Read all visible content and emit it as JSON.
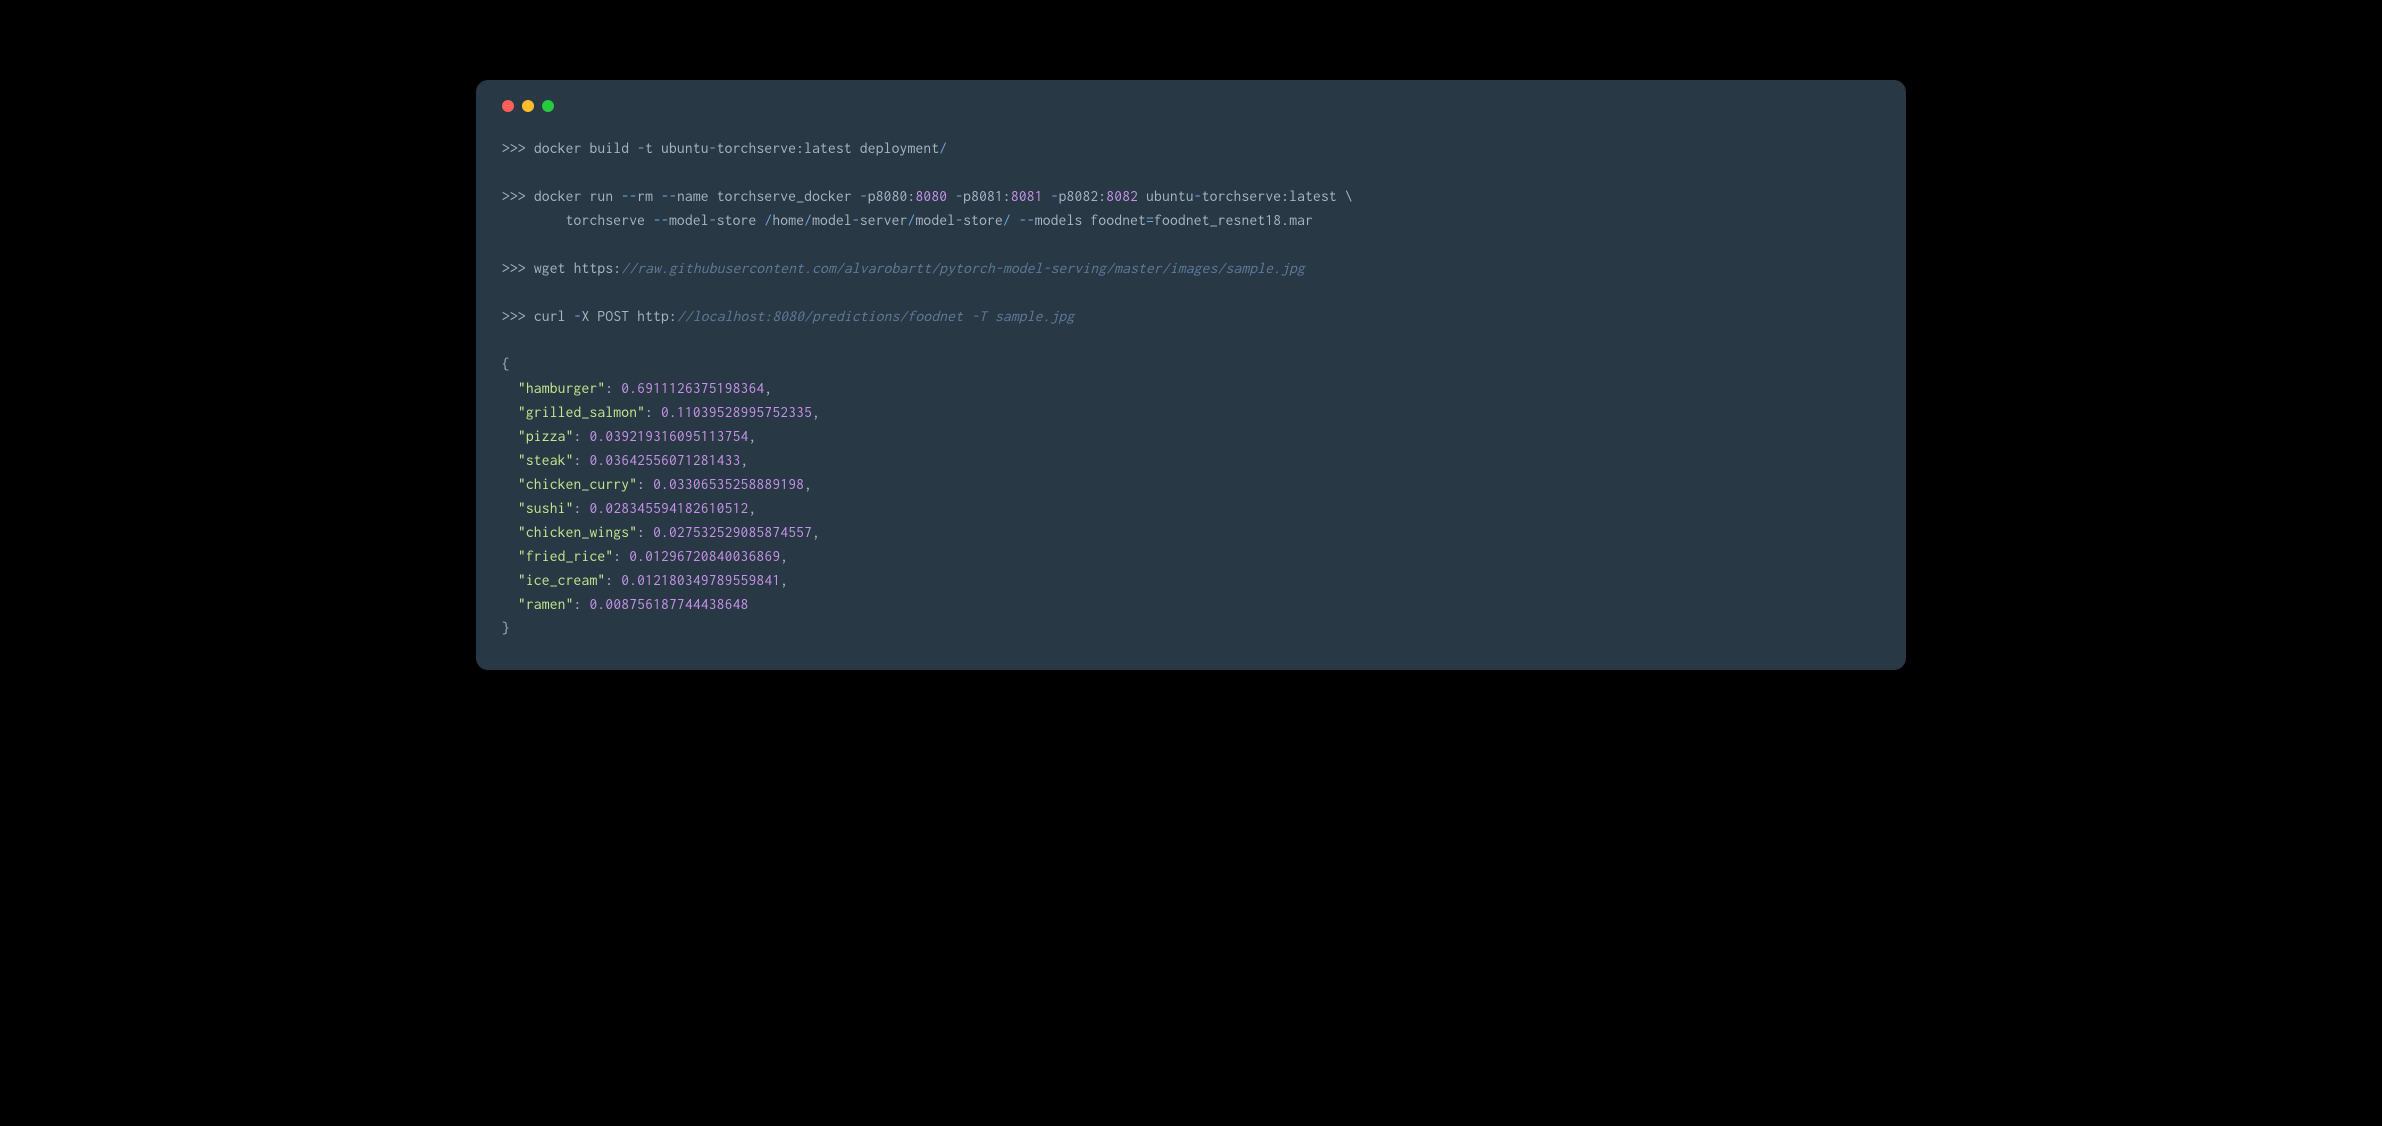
{
  "colors": {
    "bg": "#000000",
    "window_bg": "#293845",
    "text": "#a6b4c4",
    "operator": "#6ea3d6",
    "number": "#c792ea",
    "string": "#c3e88d",
    "comment": "#5f7a99",
    "tl_red": "#ff5f56",
    "tl_yellow": "#ffbd2e",
    "tl_green": "#27c93f"
  },
  "lines": [
    {
      "type": "cmd",
      "tokens": [
        {
          "cls": "prompt",
          "text": ">>> "
        },
        {
          "cls": "text",
          "text": "docker build "
        },
        {
          "cls": "op",
          "text": "-"
        },
        {
          "cls": "text",
          "text": "t ubuntu"
        },
        {
          "cls": "op",
          "text": "-"
        },
        {
          "cls": "text",
          "text": "torchserve:latest deployment"
        },
        {
          "cls": "op",
          "text": "/"
        }
      ]
    },
    {
      "type": "blank"
    },
    {
      "type": "cmd",
      "tokens": [
        {
          "cls": "prompt",
          "text": ">>> "
        },
        {
          "cls": "text",
          "text": "docker run "
        },
        {
          "cls": "op",
          "text": "--"
        },
        {
          "cls": "text",
          "text": "rm "
        },
        {
          "cls": "op",
          "text": "--"
        },
        {
          "cls": "text",
          "text": "name torchserve_docker "
        },
        {
          "cls": "op",
          "text": "-"
        },
        {
          "cls": "text",
          "text": "p8080:"
        },
        {
          "cls": "num",
          "text": "8080"
        },
        {
          "cls": "text",
          "text": " "
        },
        {
          "cls": "op",
          "text": "-"
        },
        {
          "cls": "text",
          "text": "p8081:"
        },
        {
          "cls": "num",
          "text": "8081"
        },
        {
          "cls": "text",
          "text": " "
        },
        {
          "cls": "op",
          "text": "-"
        },
        {
          "cls": "text",
          "text": "p8082:"
        },
        {
          "cls": "num",
          "text": "8082"
        },
        {
          "cls": "text",
          "text": " ubuntu"
        },
        {
          "cls": "op",
          "text": "-"
        },
        {
          "cls": "text",
          "text": "torchserve:latest \\"
        }
      ]
    },
    {
      "type": "cmd",
      "tokens": [
        {
          "cls": "text",
          "text": "        torchserve "
        },
        {
          "cls": "op",
          "text": "--"
        },
        {
          "cls": "text",
          "text": "model"
        },
        {
          "cls": "op",
          "text": "-"
        },
        {
          "cls": "text",
          "text": "store "
        },
        {
          "cls": "op",
          "text": "/"
        },
        {
          "cls": "text",
          "text": "home"
        },
        {
          "cls": "op",
          "text": "/"
        },
        {
          "cls": "text",
          "text": "model"
        },
        {
          "cls": "op",
          "text": "-"
        },
        {
          "cls": "text",
          "text": "server"
        },
        {
          "cls": "op",
          "text": "/"
        },
        {
          "cls": "text",
          "text": "model"
        },
        {
          "cls": "op",
          "text": "-"
        },
        {
          "cls": "text",
          "text": "store"
        },
        {
          "cls": "op",
          "text": "/"
        },
        {
          "cls": "text",
          "text": " "
        },
        {
          "cls": "op",
          "text": "--"
        },
        {
          "cls": "text",
          "text": "models foodnet"
        },
        {
          "cls": "op",
          "text": "="
        },
        {
          "cls": "text",
          "text": "foodnet_resnet18.mar"
        }
      ]
    },
    {
      "type": "blank"
    },
    {
      "type": "cmd",
      "tokens": [
        {
          "cls": "prompt",
          "text": ">>> "
        },
        {
          "cls": "text",
          "text": "wget https:"
        },
        {
          "cls": "comment",
          "text": "//raw.githubusercontent.com/alvarobartt/pytorch-model-serving/master/images/sample.jpg"
        }
      ]
    },
    {
      "type": "blank"
    },
    {
      "type": "cmd",
      "tokens": [
        {
          "cls": "prompt",
          "text": ">>> "
        },
        {
          "cls": "text",
          "text": "curl "
        },
        {
          "cls": "op",
          "text": "-"
        },
        {
          "cls": "text",
          "text": "X POST http:"
        },
        {
          "cls": "comment",
          "text": "//localhost:8080/predictions/foodnet -T sample.jpg"
        }
      ]
    },
    {
      "type": "blank"
    },
    {
      "type": "output",
      "tokens": [
        {
          "cls": "punct",
          "text": "{"
        }
      ]
    },
    {
      "type": "output",
      "tokens": [
        {
          "cls": "text",
          "text": "  "
        },
        {
          "cls": "str",
          "text": "\"hamburger\""
        },
        {
          "cls": "punct",
          "text": ": "
        },
        {
          "cls": "num",
          "text": "0.6911126375198364"
        },
        {
          "cls": "punct",
          "text": ","
        }
      ]
    },
    {
      "type": "output",
      "tokens": [
        {
          "cls": "text",
          "text": "  "
        },
        {
          "cls": "str",
          "text": "\"grilled_salmon\""
        },
        {
          "cls": "punct",
          "text": ": "
        },
        {
          "cls": "num",
          "text": "0.11039528995752335"
        },
        {
          "cls": "punct",
          "text": ","
        }
      ]
    },
    {
      "type": "output",
      "tokens": [
        {
          "cls": "text",
          "text": "  "
        },
        {
          "cls": "str",
          "text": "\"pizza\""
        },
        {
          "cls": "punct",
          "text": ": "
        },
        {
          "cls": "num",
          "text": "0.039219316095113754"
        },
        {
          "cls": "punct",
          "text": ","
        }
      ]
    },
    {
      "type": "output",
      "tokens": [
        {
          "cls": "text",
          "text": "  "
        },
        {
          "cls": "str",
          "text": "\"steak\""
        },
        {
          "cls": "punct",
          "text": ": "
        },
        {
          "cls": "num",
          "text": "0.03642556071281433"
        },
        {
          "cls": "punct",
          "text": ","
        }
      ]
    },
    {
      "type": "output",
      "tokens": [
        {
          "cls": "text",
          "text": "  "
        },
        {
          "cls": "str",
          "text": "\"chicken_curry\""
        },
        {
          "cls": "punct",
          "text": ": "
        },
        {
          "cls": "num",
          "text": "0.03306535258889198"
        },
        {
          "cls": "punct",
          "text": ","
        }
      ]
    },
    {
      "type": "output",
      "tokens": [
        {
          "cls": "text",
          "text": "  "
        },
        {
          "cls": "str",
          "text": "\"sushi\""
        },
        {
          "cls": "punct",
          "text": ": "
        },
        {
          "cls": "num",
          "text": "0.028345594182610512"
        },
        {
          "cls": "punct",
          "text": ","
        }
      ]
    },
    {
      "type": "output",
      "tokens": [
        {
          "cls": "text",
          "text": "  "
        },
        {
          "cls": "str",
          "text": "\"chicken_wings\""
        },
        {
          "cls": "punct",
          "text": ": "
        },
        {
          "cls": "num",
          "text": "0.027532529085874557"
        },
        {
          "cls": "punct",
          "text": ","
        }
      ]
    },
    {
      "type": "output",
      "tokens": [
        {
          "cls": "text",
          "text": "  "
        },
        {
          "cls": "str",
          "text": "\"fried_rice\""
        },
        {
          "cls": "punct",
          "text": ": "
        },
        {
          "cls": "num",
          "text": "0.01296720840036869"
        },
        {
          "cls": "punct",
          "text": ","
        }
      ]
    },
    {
      "type": "output",
      "tokens": [
        {
          "cls": "text",
          "text": "  "
        },
        {
          "cls": "str",
          "text": "\"ice_cream\""
        },
        {
          "cls": "punct",
          "text": ": "
        },
        {
          "cls": "num",
          "text": "0.012180349789559841"
        },
        {
          "cls": "punct",
          "text": ","
        }
      ]
    },
    {
      "type": "output",
      "tokens": [
        {
          "cls": "text",
          "text": "  "
        },
        {
          "cls": "str",
          "text": "\"ramen\""
        },
        {
          "cls": "punct",
          "text": ": "
        },
        {
          "cls": "num",
          "text": "0.008756187744438648"
        }
      ]
    },
    {
      "type": "output",
      "tokens": [
        {
          "cls": "punct",
          "text": "}"
        }
      ]
    }
  ]
}
